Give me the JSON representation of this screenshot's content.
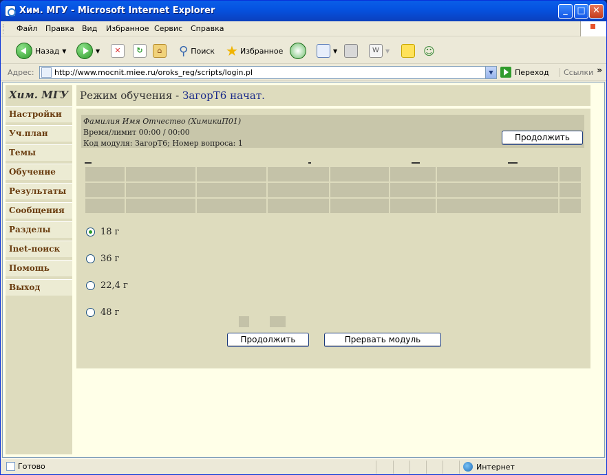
{
  "window": {
    "title": "Хим. МГУ - Microsoft Internet Explorer"
  },
  "menu": [
    "Файл",
    "Правка",
    "Вид",
    "Избранное",
    "Сервис",
    "Справка"
  ],
  "toolbar": {
    "back": "Назад",
    "search": "Поиск",
    "favorites": "Избранное"
  },
  "address": {
    "label": "Адрес:",
    "url": "http://www.mocnit.miee.ru/oroks_reg/scripts/login.pl",
    "go": "Переход",
    "links": "Ссылки"
  },
  "sidebar": {
    "title": "Хим. МГУ",
    "items": [
      "Настройки",
      "Уч.план",
      "Темы",
      "Обучение",
      "Результаты",
      "Сообщения",
      "Разделы",
      "Inet-поиск",
      "Помощь",
      "Выход"
    ]
  },
  "header": {
    "prefix": "Режим обучения -",
    "module": "ЗагорТ6 начат."
  },
  "info": {
    "name": "Фамилия Имя Отчество (ХимикиП01)",
    "time": "Время/лимит 00:00 / 00:00",
    "module": "Код модуля: ЗагорТ6; Номер вопроса: 1",
    "continue_top": "Продолжить"
  },
  "answers": [
    {
      "label": "18 г",
      "selected": true
    },
    {
      "label": "36 г",
      "selected": false
    },
    {
      "label": "22,4 г",
      "selected": false
    },
    {
      "label": "48 г",
      "selected": false
    }
  ],
  "buttons": {
    "continue": "Продолжить",
    "abort": "Прервать модуль"
  },
  "status": {
    "text": "Готово",
    "zone": "Интернет"
  }
}
